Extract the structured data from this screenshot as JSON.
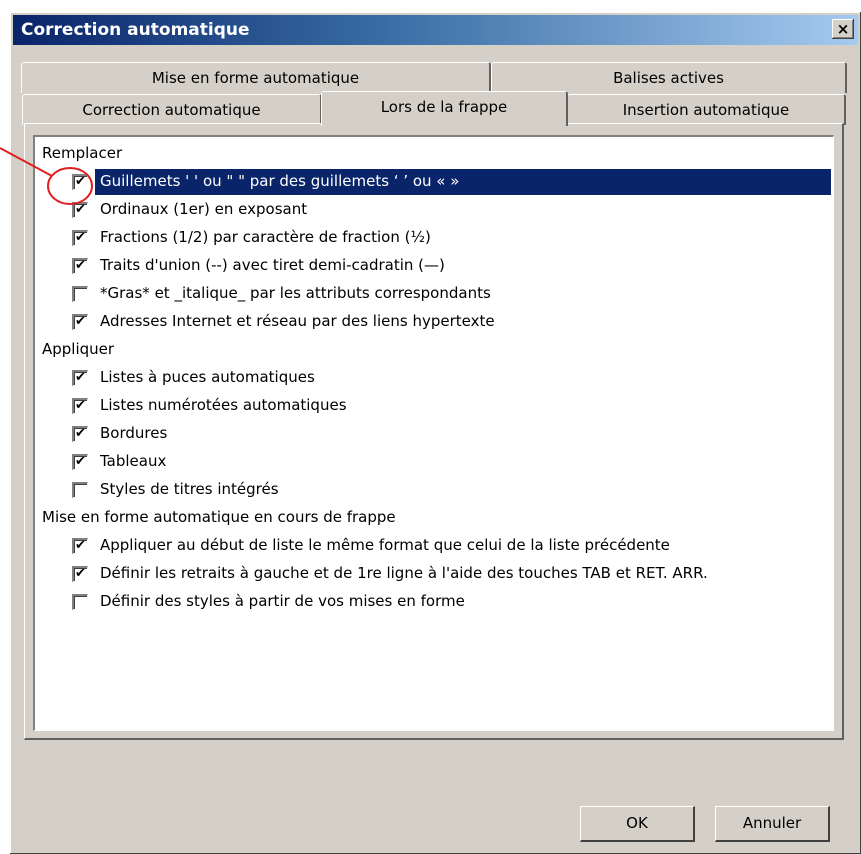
{
  "window": {
    "title": "Correction automatique",
    "close_label": "×"
  },
  "tabs": {
    "back": [
      {
        "label": "Mise en forme automatique"
      },
      {
        "label": "Balises actives"
      }
    ],
    "front": [
      {
        "label": "Correction automatique"
      },
      {
        "label": "Lors de la frappe",
        "active": true
      },
      {
        "label": "Insertion automatique"
      }
    ]
  },
  "groups": {
    "replace": {
      "label": "Remplacer",
      "items": [
        {
          "label": "Guillemets ' ' ou \" \" par des guillemets ‘ ’ ou « »",
          "checked": true,
          "selected": true
        },
        {
          "label": "Ordinaux (1er) en exposant",
          "checked": true
        },
        {
          "label": "Fractions (1/2) par caractère de fraction (½)",
          "checked": true
        },
        {
          "label": "Traits d'union (--) avec tiret demi-cadratin (—)",
          "checked": true
        },
        {
          "label": "*Gras* et _italique_ par les attributs correspondants",
          "checked": false
        },
        {
          "label": "Adresses Internet et réseau par des liens hypertexte",
          "checked": true
        }
      ]
    },
    "apply": {
      "label": "Appliquer",
      "items": [
        {
          "label": "Listes à puces automatiques",
          "checked": true
        },
        {
          "label": "Listes numérotées automatiques",
          "checked": true
        },
        {
          "label": "Bordures",
          "checked": true
        },
        {
          "label": "Tableaux",
          "checked": true
        },
        {
          "label": "Styles de titres intégrés",
          "checked": false
        }
      ]
    },
    "format": {
      "label": "Mise en forme automatique en cours de frappe",
      "items": [
        {
          "label": "Appliquer au début de liste le même format que celui de la liste précédente",
          "checked": true
        },
        {
          "label": "Définir les retraits à gauche et de 1re ligne à l'aide des touches TAB et RET. ARR.",
          "checked": true
        },
        {
          "label": "Définir des styles à partir de vos mises en forme",
          "checked": false
        }
      ]
    }
  },
  "buttons": {
    "ok": "OK",
    "cancel": "Annuler"
  },
  "checkmark": "✔",
  "colors": {
    "selection": "#0a246a",
    "annotation": "#e02020"
  }
}
